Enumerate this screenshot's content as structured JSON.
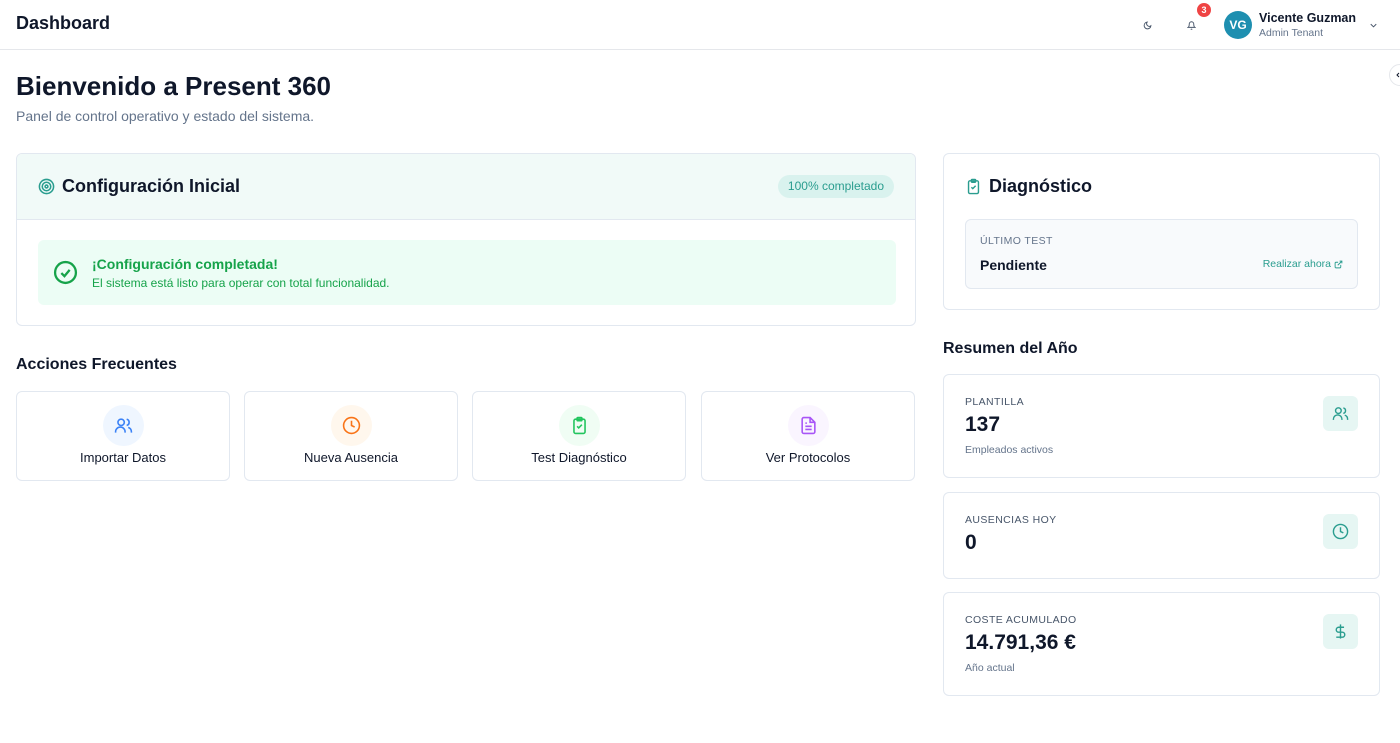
{
  "header": {
    "title": "Dashboard",
    "notifications_count": "3",
    "user": {
      "initials": "VG",
      "name": "Vicente Guzman",
      "role": "Admin Tenant"
    }
  },
  "page": {
    "title": "Bienvenido a Present 360",
    "subtitle": "Panel de control operativo y estado del sistema."
  },
  "config": {
    "title": "Configuración Inicial",
    "progress_label": "100% completado",
    "success_title": "¡Configuración completada!",
    "success_desc": "El sistema está listo para operar con total funcionalidad."
  },
  "actions": {
    "title": "Acciones Frecuentes",
    "items": [
      {
        "label": "Importar Datos",
        "icon": "users-icon"
      },
      {
        "label": "Nueva Ausencia",
        "icon": "clock-icon"
      },
      {
        "label": "Test Diagnóstico",
        "icon": "clipboard-check-icon"
      },
      {
        "label": "Ver Protocolos",
        "icon": "file-text-icon"
      }
    ]
  },
  "diagnostic": {
    "title": "Diagnóstico",
    "last_test_label": "ÚLTIMO TEST",
    "last_test_value": "Pendiente",
    "action_label": "Realizar ahora"
  },
  "summary": {
    "title": "Resumen del Año",
    "stats": [
      {
        "label": "PLANTILLA",
        "value": "137",
        "sub": "Empleados activos",
        "icon": "users-icon"
      },
      {
        "label": "AUSENCIAS HOY",
        "value": "0",
        "sub": "",
        "icon": "clock-icon"
      },
      {
        "label": "COSTE ACUMULADO",
        "value": "14.791,36 €",
        "sub": "Año actual",
        "icon": "dollar-icon"
      }
    ]
  },
  "colors": {
    "accent": "#2a9d8f",
    "success": "#16a34a",
    "badge": "#ef4444",
    "avatar": "#1e8fb0"
  }
}
